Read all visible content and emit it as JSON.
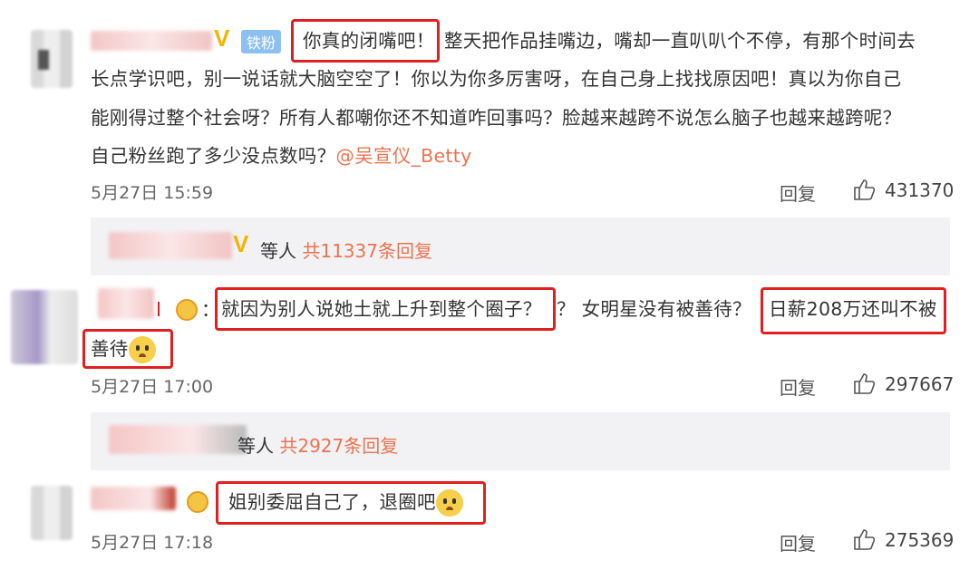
{
  "comments": [
    {
      "badge": "铁粉",
      "highlight": "你真的闭嘴吧！",
      "line1_rest": "整天把作品挂嘴边，嘴却一直叭叭个不停，有那个时间去",
      "line2": "长点学识吧，别一说话就大脑空空了！你以为你多厉害呀，在自己身上找找原因吧！真以为你自己",
      "line3": "能刚得过整个社会呀？所有人都嘲你还不知道咋回事吗？脸越来越跨不说怎么脑子也越来越跨呢？",
      "line4": "自己粉丝跑了多少没点数吗？",
      "mention": "@吴宣仪_Betty",
      "time": "5月27日 15:59",
      "reply_label": "回复",
      "likes": "431370",
      "replies_people": "等人",
      "replies_count": "共11337条回复"
    },
    {
      "prefix": "：",
      "highlight1": "就因为别人说她土就上升到整个圈子？",
      "mid": "？ 女明星没有被善待？",
      "highlight2a": "日薪208万还叫不被",
      "highlight2b": "善待",
      "time": "5月27日 17:00",
      "reply_label": "回复",
      "likes": "297667",
      "replies_people": "等人",
      "replies_count": "共2927条回复"
    },
    {
      "highlight": "姐别委屈自己了，退圈吧",
      "time": "5月27日 17:18",
      "reply_label": "回复",
      "likes": "275369"
    }
  ],
  "colors": {
    "accent": "#eb7350",
    "highlight_box": "#e02020",
    "reply_bg": "#f2f2f5"
  }
}
